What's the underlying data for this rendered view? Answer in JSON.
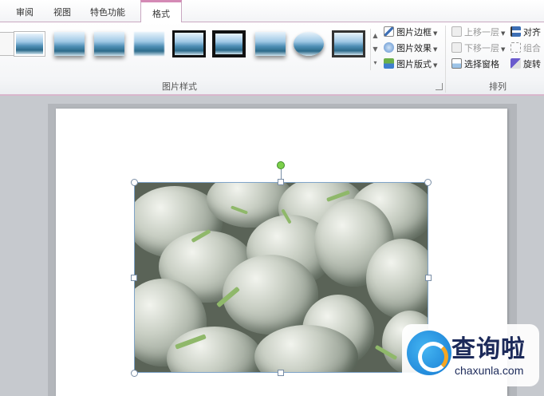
{
  "tabs": [
    {
      "label": "审阅"
    },
    {
      "label": "视图"
    },
    {
      "label": "特色功能"
    },
    {
      "label": "格式",
      "active": true
    }
  ],
  "picture_styles": {
    "group_label": "图片样式",
    "commands": {
      "border": "图片边框",
      "effects": "图片效果",
      "layout": "图片版式"
    }
  },
  "arrange": {
    "group_label": "排列",
    "commands": {
      "bring_forward": "上移一层",
      "send_backward": "下移一层",
      "selection_pane": "选择窗格",
      "align": "对齐",
      "group": "组合",
      "rotate": "旋转"
    }
  },
  "watermark": {
    "title": "查询啦",
    "subtitle": "chaxunla.com"
  },
  "colors": {
    "accent_tab": "#d48ab5",
    "selection_handle": "#7a8ea6",
    "rotate_handle": "#7cd04a"
  }
}
